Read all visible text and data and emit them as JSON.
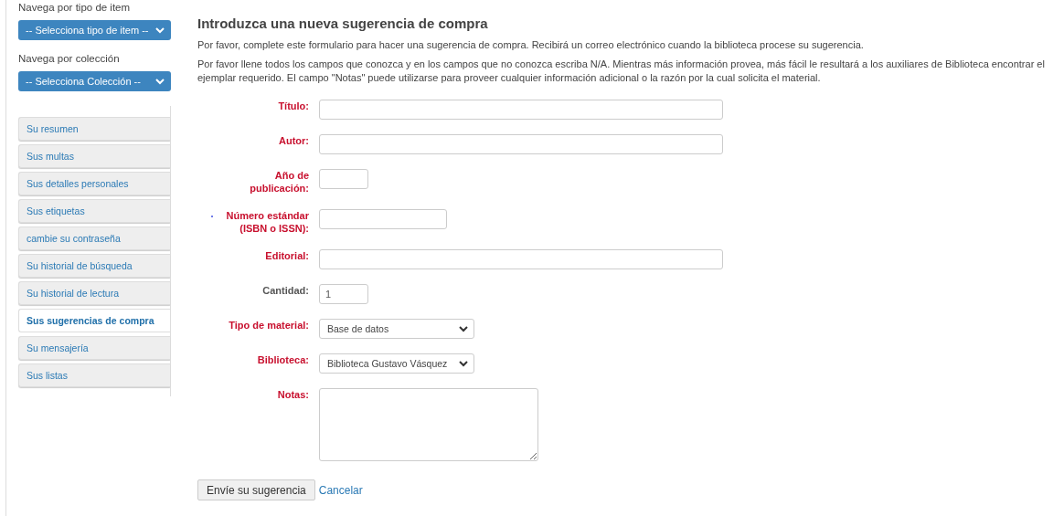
{
  "sidebar": {
    "browse": [
      {
        "label": "Navega por tipo de item",
        "select": "-- Selecciona tipo de item --"
      },
      {
        "label": "Navega por colección",
        "select": "-- Selecciona Colección --"
      }
    ],
    "menu": [
      {
        "label": "Su resumen",
        "selected": false
      },
      {
        "label": "Sus multas",
        "selected": false
      },
      {
        "label": "Sus detalles personales",
        "selected": false
      },
      {
        "label": "Sus etiquetas",
        "selected": false
      },
      {
        "label": "cambie su contraseña",
        "selected": false
      },
      {
        "label": "Su historial de búsqueda",
        "selected": false
      },
      {
        "label": "Su historial de lectura",
        "selected": false
      },
      {
        "label": "Sus sugerencias de compra",
        "selected": true
      },
      {
        "label": "Su mensajería",
        "selected": false
      },
      {
        "label": "Sus listas",
        "selected": false
      }
    ]
  },
  "form": {
    "title": "Introduzca una nueva sugerencia de compra",
    "intro": [
      "Por favor, complete este formulario para hacer una sugerencia de compra. Recibirá un correo electrónico cuando la biblioteca procese su sugerencia.",
      "Por favor llene todos los campos que conozca y en los campos que no conozca escriba N/A. Mientras más información provea, más fácil le resultará a los auxiliares de Biblioteca encontrar el ejemplar requerido. El campo \"Notas\" puede utilizarse para proveer cualquier información adicional o la razón por la cual solicita el material."
    ],
    "fields": [
      {
        "label": "Título:",
        "kind": "long-text",
        "required": true,
        "marked": false
      },
      {
        "label": "Autor:",
        "kind": "long-text",
        "required": true,
        "marked": false
      },
      {
        "label": "Año de publicación:",
        "kind": "short-text",
        "required": true,
        "marked": false
      },
      {
        "label": "Número estándar (ISBN o ISSN):",
        "kind": "medium-text",
        "required": true,
        "marked": true
      },
      {
        "label": "Editorial:",
        "kind": "long-text",
        "required": true,
        "marked": false
      },
      {
        "label": "Cantidad:",
        "kind": "short-text",
        "required": false,
        "marked": false,
        "value": "1"
      },
      {
        "label": "Tipo de material:",
        "kind": "select",
        "required": true,
        "marked": false,
        "value": "Base de datos"
      },
      {
        "label": "Biblioteca:",
        "kind": "select",
        "required": true,
        "marked": false,
        "value": "Biblioteca Gustavo Vásquez"
      },
      {
        "label": "Notas:",
        "kind": "textarea",
        "required": true,
        "marked": false
      }
    ],
    "submit": "Envíe su sugerencia",
    "cancel": "Cancelar"
  }
}
